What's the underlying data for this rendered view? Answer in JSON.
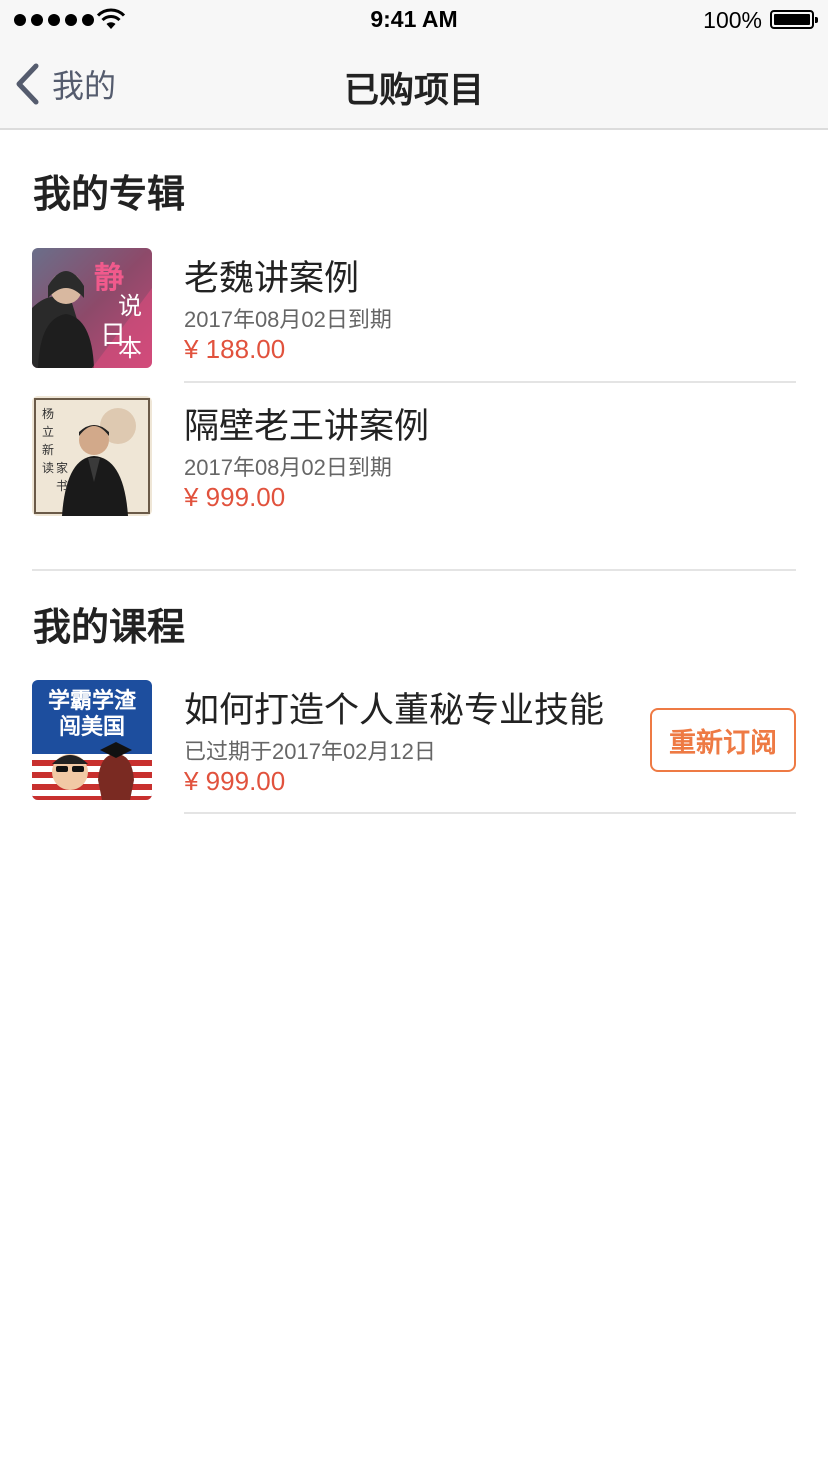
{
  "status_bar": {
    "time": "9:41 AM",
    "battery": "100%"
  },
  "nav": {
    "back_label": "我的",
    "title": "已购项目"
  },
  "albums": {
    "heading": "我的专辑",
    "items": [
      {
        "title": "老魏讲案例",
        "subtitle": "2017年08月02日到期",
        "price": "¥ 188.00",
        "cover_text": [
          "静",
          "说",
          "日",
          "本"
        ]
      },
      {
        "title": "隔壁老王讲案例",
        "subtitle": "2017年08月02日到期",
        "price": "¥ 999.00",
        "cover_text": [
          "杨",
          "立",
          "新",
          "读",
          "家",
          "书"
        ]
      }
    ]
  },
  "courses": {
    "heading": "我的课程",
    "items": [
      {
        "title": "如何打造个人董秘专业技能",
        "subtitle": "已过期于2017年02月12日",
        "price": "¥ 999.00",
        "action_label": "重新订阅",
        "cover_text": [
          "学霸学渣",
          "闯美国"
        ]
      }
    ]
  },
  "colors": {
    "price": "#e1523d",
    "accent": "#ee7a44",
    "nav_back": "#555c6e"
  }
}
